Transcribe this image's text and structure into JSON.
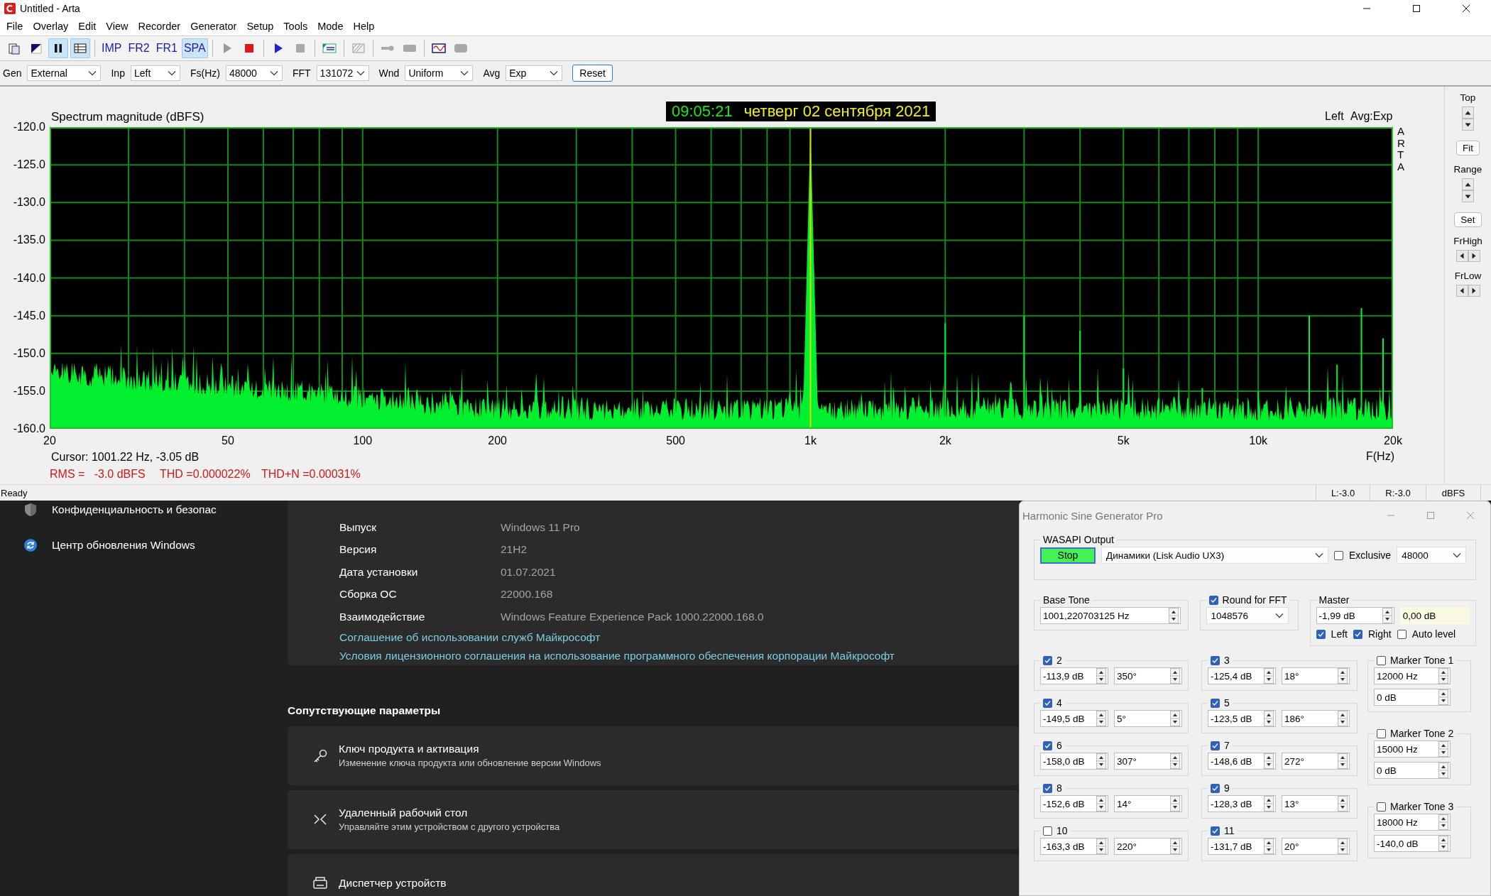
{
  "window": {
    "title": "Untitled - Arta"
  },
  "menu": [
    "File",
    "Overlay",
    "Edit",
    "View",
    "Recorder",
    "Generator",
    "Setup",
    "Tools",
    "Mode",
    "Help"
  ],
  "toolbar": [
    [
      {
        "kind": "icon",
        "pressed": false
      },
      {
        "kind": "icon",
        "pressed": false
      },
      {
        "kind": "icon",
        "pressed": true
      },
      {
        "kind": "icon",
        "pressed": true
      }
    ],
    [
      {
        "kind": "text",
        "label": "IMP",
        "pressed": false
      },
      {
        "kind": "text",
        "label": "FR2",
        "pressed": false
      },
      {
        "kind": "text",
        "label": "FR1",
        "pressed": false
      },
      {
        "kind": "text",
        "label": "SPA",
        "pressed": true
      }
    ],
    [
      {
        "kind": "icon",
        "pressed": false
      },
      {
        "kind": "icon",
        "pressed": false
      }
    ],
    [
      {
        "kind": "icon",
        "pressed": false
      },
      {
        "kind": "icon",
        "pressed": false
      }
    ],
    [
      {
        "kind": "icon",
        "pressed": false
      }
    ],
    [
      {
        "kind": "icon",
        "pressed": false
      }
    ],
    [
      {
        "kind": "icon",
        "pressed": false
      },
      {
        "kind": "icon",
        "pressed": false
      }
    ],
    [
      {
        "kind": "icon",
        "pressed": false
      },
      {
        "kind": "icon",
        "pressed": false
      }
    ]
  ],
  "controls": [
    {
      "label": "Gen",
      "value": "External"
    },
    {
      "label": "Inp",
      "value": "Left"
    },
    {
      "label": "Fs(Hz)",
      "value": "48000"
    },
    {
      "label": "FFT",
      "value": "131072"
    },
    {
      "label": "Wnd",
      "value": "Uniform"
    },
    {
      "label": "Avg",
      "value": "Exp"
    }
  ],
  "reset_button": "Reset",
  "plot": {
    "title": "Spectrum magnitude (dBFS)",
    "clock_time": "09:05:21",
    "clock_date": "четверг 02 сентября 2021",
    "channel": "Left",
    "averaging": "Avg:Exp",
    "brand": "ARTA",
    "y_ticks": [
      "-120.0",
      "-125.0",
      "-130.0",
      "-135.0",
      "-140.0",
      "-145.0",
      "-150.0",
      "-155.0",
      "-160.0"
    ],
    "x_ticks": [
      "20",
      "50",
      "100",
      "200",
      "500",
      "1k",
      "2k",
      "5k",
      "10k",
      "20k"
    ],
    "x_label": "F(Hz)",
    "cursor": "Cursor: 1001.22 Hz, -3.05 dB",
    "rms": "RMS =   -3.0 dBFS",
    "thd": "THD =0.000022%",
    "thdn": "THD+N =0.00031%"
  },
  "side_panel": {
    "top": "Top",
    "fit": "Fit",
    "range": "Range",
    "set": "Set",
    "fr_high": "FrHigh",
    "fr_low": "FrLow"
  },
  "status_bar": [
    "Ready",
    "L:-3.0",
    "R:-3.0",
    "dBFS"
  ],
  "settings": {
    "nav": [
      {
        "label": "Конфиденциальность и безопас"
      },
      {
        "label": "Центр обновления Windows"
      }
    ],
    "specs": [
      {
        "label": "Выпуск",
        "value": "Windows 11 Pro"
      },
      {
        "label": "Версия",
        "value": "21H2"
      },
      {
        "label": "Дата установки",
        "value": "01.07.2021"
      },
      {
        "label": "Сборка ОС",
        "value": "22000.168"
      },
      {
        "label": "Взаимодействие",
        "value": "Windows Feature Experience Pack 1000.22000.168.0"
      }
    ],
    "links": [
      "Соглашение об использовании служб Майкрософт",
      "Условия лицензионного соглашения на использование программного обеспечения корпорации Майкрософт"
    ],
    "related_heading": "Сопутствующие параметры",
    "related": [
      {
        "title": "Ключ продукта и активация",
        "subtitle": "Изменение ключа продукта или обновление версии Windows"
      },
      {
        "title": "Удаленный рабочий стол",
        "subtitle": "Управляйте этим устройством с другого устройства"
      },
      {
        "title": "Диспетчер устройств"
      }
    ]
  },
  "generator": {
    "title": "Harmonic Sine Generator Pro",
    "output_group": "WASAPI Output",
    "stop_button": "Stop",
    "device": "Динамики (Lisk Audio UX3)",
    "exclusive": {
      "label": "Exclusive",
      "checked": false
    },
    "rate": "48000",
    "base_tone": {
      "label": "Base Tone",
      "value": "1001,220703125 Hz"
    },
    "round_fft": {
      "label": "Round for FFT",
      "checked": true,
      "value": "1048576"
    },
    "master": {
      "label": "Master",
      "value": "-1,99 dB",
      "readout": "0,00 dB",
      "left": {
        "label": "Left",
        "checked": true
      },
      "right": {
        "label": "Right",
        "checked": true
      },
      "auto_level": {
        "label": "Auto level",
        "checked": false
      }
    },
    "harmonics": [
      {
        "label": "2",
        "checked": true,
        "amplitude": "-113,9 dB",
        "phase": "350°"
      },
      {
        "label": "3",
        "checked": true,
        "amplitude": "-125,4 dB",
        "phase": "18°"
      },
      {
        "label": "4",
        "checked": true,
        "amplitude": "-149,5 dB",
        "phase": "5°"
      },
      {
        "label": "5",
        "checked": true,
        "amplitude": "-123,5 dB",
        "phase": "186°"
      },
      {
        "label": "6",
        "checked": true,
        "amplitude": "-158,0 dB",
        "phase": "307°"
      },
      {
        "label": "7",
        "checked": true,
        "amplitude": "-148,6 dB",
        "phase": "272°"
      },
      {
        "label": "8",
        "checked": true,
        "amplitude": "-152,6 dB",
        "phase": "14°"
      },
      {
        "label": "9",
        "checked": true,
        "amplitude": "-128,3 dB",
        "phase": "13°"
      },
      {
        "label": "10",
        "checked": false,
        "amplitude": "-163,3 dB",
        "phase": "220°"
      },
      {
        "label": "11",
        "checked": true,
        "amplitude": "-131,7 dB",
        "phase": "20°"
      }
    ],
    "markers": [
      {
        "label": "Marker Tone 1",
        "checked": false,
        "frequency": "12000 Hz",
        "amplitude": "0 dB"
      },
      {
        "label": "Marker Tone 2",
        "checked": false,
        "frequency": "15000 Hz",
        "amplitude": "0 dB"
      },
      {
        "label": "Marker Tone 3",
        "checked": false,
        "frequency": "18000 Hz",
        "amplitude": "-140,0 dB"
      }
    ]
  }
}
